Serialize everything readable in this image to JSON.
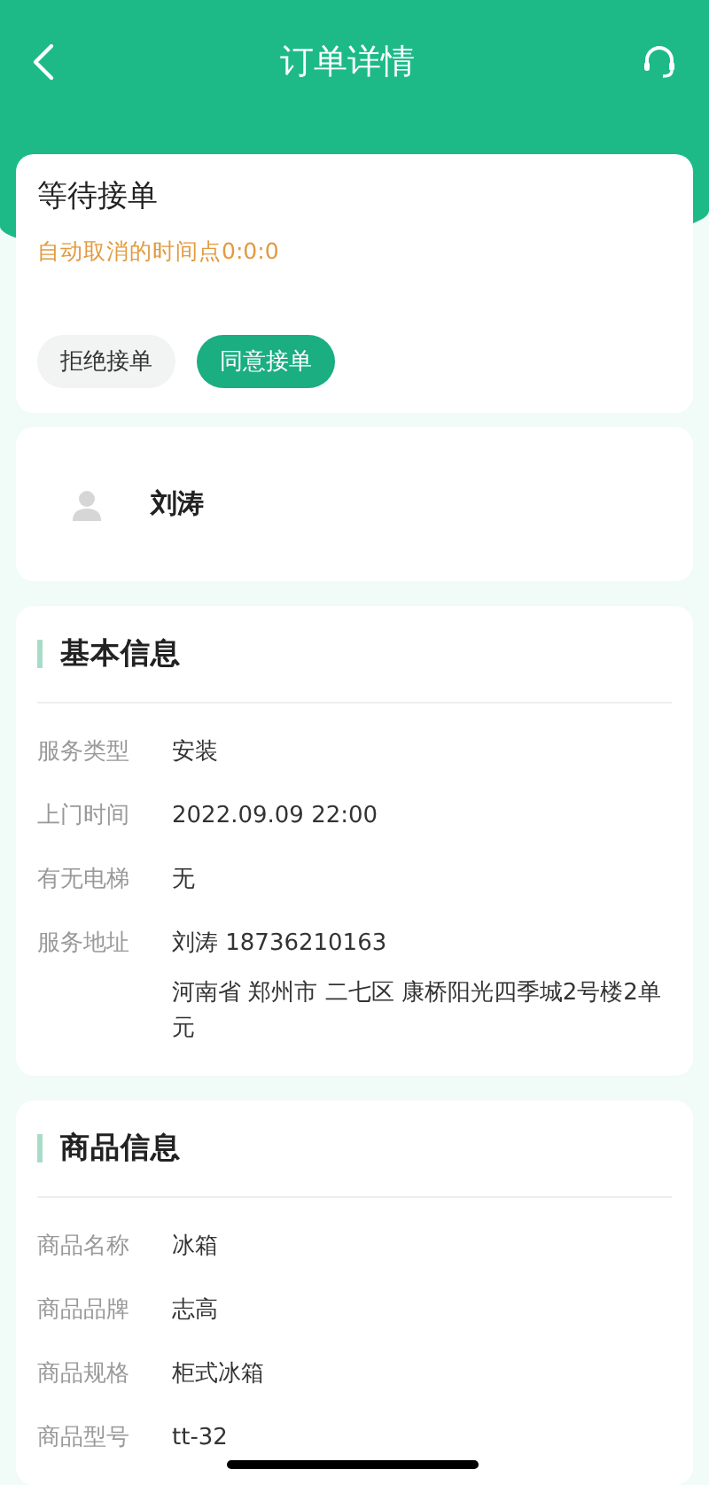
{
  "nav": {
    "title": "订单详情"
  },
  "status": {
    "title": "等待接单",
    "notice": "自动取消的时间点0:0:0",
    "buttons": [
      {
        "label": "拒绝接单",
        "kind": "secondary"
      },
      {
        "label": "同意接单",
        "kind": "primary"
      }
    ]
  },
  "customer": {
    "name": "刘涛"
  },
  "sections": [
    {
      "title": "基本信息",
      "fields": [
        {
          "label": "服务类型",
          "values": [
            "安装"
          ]
        },
        {
          "label": "上门时间",
          "values": [
            "2022.09.09 22:00"
          ]
        },
        {
          "label": "有无电梯",
          "values": [
            "无"
          ]
        },
        {
          "label": "服务地址",
          "values": [
            "刘涛 18736210163",
            "河南省 郑州市 二七区 康桥阳光四季城2号楼2单元"
          ]
        }
      ]
    },
    {
      "title": "商品信息",
      "fields": [
        {
          "label": "商品名称",
          "values": [
            "冰箱"
          ]
        },
        {
          "label": "商品品牌",
          "values": [
            "志高"
          ]
        },
        {
          "label": "商品规格",
          "values": [
            "柜式冰箱"
          ]
        },
        {
          "label": "商品型号",
          "values": [
            "tt-32"
          ]
        }
      ]
    }
  ]
}
